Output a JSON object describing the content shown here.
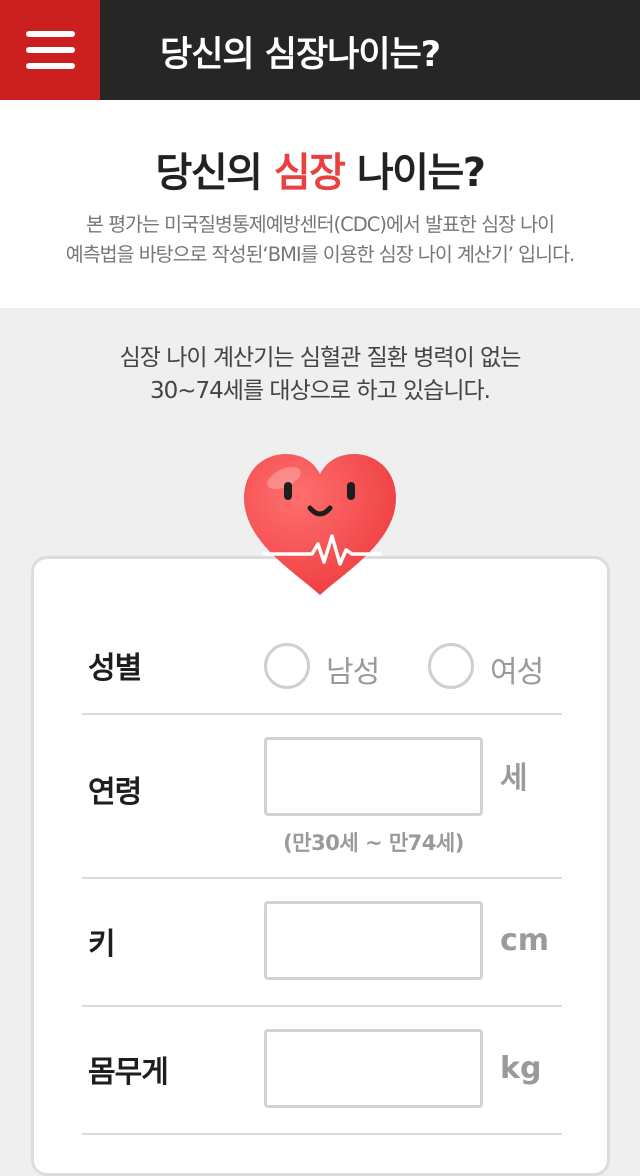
{
  "header": {
    "menu_icon": "hamburger-menu-icon",
    "title": "당신의 심장나이는?",
    "colors": {
      "bar": "#262626",
      "menu_button": "#cc1f1f"
    }
  },
  "intro": {
    "heading_before": "당신의 ",
    "heading_highlight": "심장",
    "heading_after": " 나이는?",
    "description_line1": "본 평가는 미국질병통제예방센터(CDC)에서 발표한 심장 나이",
    "description_line2": "예측법을 바탕으로 작성된‘BMI를 이용한 심장 나이 계산기’ 입니다.",
    "highlight_color": "#e8413f"
  },
  "notice": {
    "line1": "심장 나이 계산기는 심혈관 질환 병력이 없는",
    "line2": "30~74세를 대상으로 하고 있습니다."
  },
  "mascot": {
    "icon": "smiling-heart-icon",
    "color": "#f04a4a"
  },
  "form": {
    "gender": {
      "label": "성별",
      "options": [
        {
          "label": "남성",
          "checked": false
        },
        {
          "label": "여성",
          "checked": false
        }
      ]
    },
    "age": {
      "label": "연령",
      "value": "",
      "unit": "세",
      "hint": "(만30세 ~ 만74세)"
    },
    "height": {
      "label": "키",
      "value": "",
      "unit": "cm"
    },
    "weight": {
      "label": "몸무게",
      "value": "",
      "unit": "kg"
    }
  }
}
